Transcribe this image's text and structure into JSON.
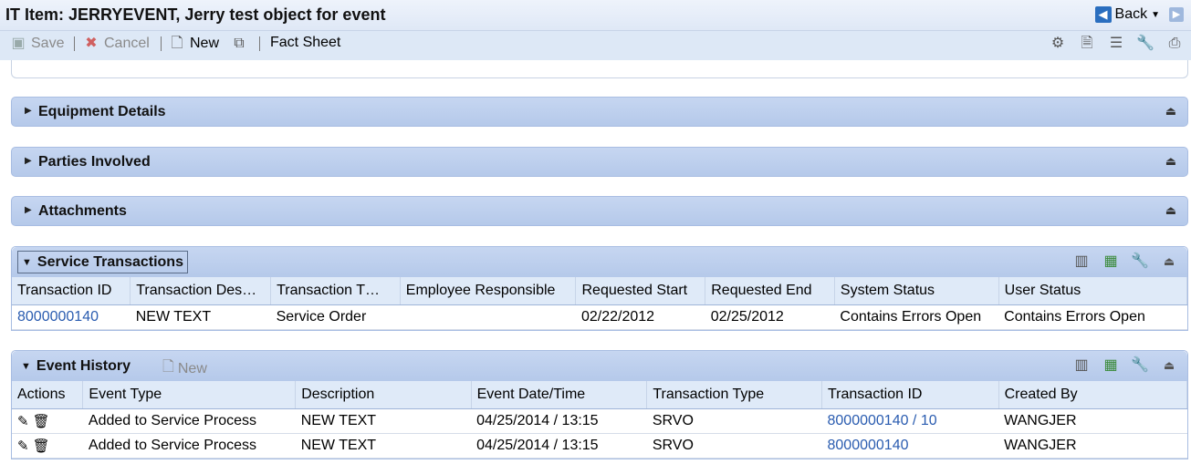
{
  "window": {
    "title": "IT Item: JERRYEVENT, Jerry test object for event",
    "back_label": "Back"
  },
  "toolbar": {
    "save_label": "Save",
    "cancel_label": "Cancel",
    "new_label": "New",
    "fact_sheet_label": "Fact Sheet"
  },
  "sections": [
    {
      "label": "Equipment Details"
    },
    {
      "label": "Parties Involved"
    },
    {
      "label": "Attachments"
    }
  ],
  "service_transactions": {
    "title": "Service Transactions",
    "columns": [
      "Transaction ID",
      "Transaction Des…",
      "Transaction T…",
      "Employee Responsible",
      "Requested Start",
      "Requested End",
      "System Status",
      "User Status"
    ],
    "rows": [
      [
        "8000000140",
        "NEW TEXT",
        "Service Order",
        "",
        "02/22/2012",
        "02/25/2012",
        "Contains Errors Open",
        "Contains Errors Open"
      ]
    ]
  },
  "event_history": {
    "title": "Event History",
    "new_label": "New",
    "columns": [
      "Actions",
      "Event Type",
      "Description",
      "Event Date/Time",
      "Transaction Type",
      "Transaction ID",
      "Created By"
    ],
    "rows": [
      [
        "",
        "Added to Service Process",
        "NEW TEXT",
        "04/25/2014 / 13:15",
        "SRVO",
        "8000000140 / 10",
        "WANGJER"
      ],
      [
        "",
        "Added to Service Process",
        "NEW TEXT",
        "04/25/2014 / 13:15",
        "SRVO",
        "8000000140",
        "WANGJER"
      ]
    ]
  },
  "colors": {
    "link": "#2a5cb0",
    "section_header": "#b5c9ea",
    "table_header": "#dfeaf8"
  }
}
